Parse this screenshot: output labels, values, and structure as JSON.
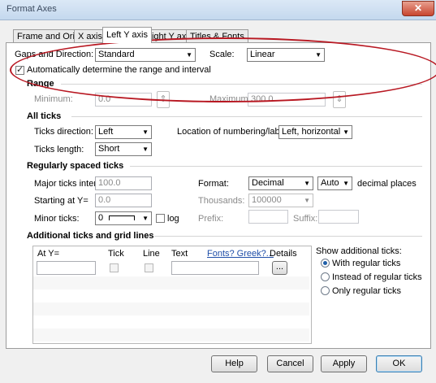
{
  "window": {
    "title": "Format Axes"
  },
  "tabs": [
    "Frame and Origin",
    "X axis",
    "Left Y axis",
    "Right Y axis",
    "Titles & Fonts"
  ],
  "gaps": {
    "label": "Gaps and Direction:",
    "value": "Standard",
    "scale_label": "Scale:",
    "scale_value": "Linear",
    "auto_label": "Automatically determine the range and interval",
    "auto_checked": true
  },
  "range": {
    "title": "Range",
    "min_label": "Minimum:",
    "min_value": "0.0",
    "max_label": "Maximum:",
    "max_value": "300.0"
  },
  "all_ticks": {
    "title": "All ticks",
    "direction_label": "Ticks direction:",
    "direction_value": "Left",
    "location_label": "Location of numbering/labeling:",
    "location_value": "Left, horizontal",
    "length_label": "Ticks length:",
    "length_value": "Short"
  },
  "regular": {
    "title": "Regularly spaced ticks",
    "major_label": "Major ticks interval:",
    "major_value": "100.0",
    "format_label": "Format:",
    "format_value": "Decimal",
    "places_value": "Auto",
    "places_label": "decimal places",
    "start_label": "Starting at Y=",
    "start_value": "0.0",
    "thousands_label": "Thousands:",
    "thousands_value": "100000",
    "minor_label": "Minor ticks:",
    "minor_value": "0",
    "log_label": "log",
    "prefix_label": "Prefix:",
    "suffix_label": "Suffix:"
  },
  "additional": {
    "title": "Additional ticks and grid lines",
    "columns": [
      "At Y=",
      "Tick",
      "Line",
      "Text"
    ],
    "fonts_link": "Fonts? Greek?...",
    "details_col": "Details",
    "details_button": "...",
    "show_label": "Show additional ticks:",
    "options": [
      "With regular ticks",
      "Instead of regular ticks",
      "Only regular ticks"
    ],
    "selected": 0
  },
  "buttons": {
    "help": "Help",
    "cancel": "Cancel",
    "apply": "Apply",
    "ok": "OK"
  },
  "annotation_color": "#b81822"
}
